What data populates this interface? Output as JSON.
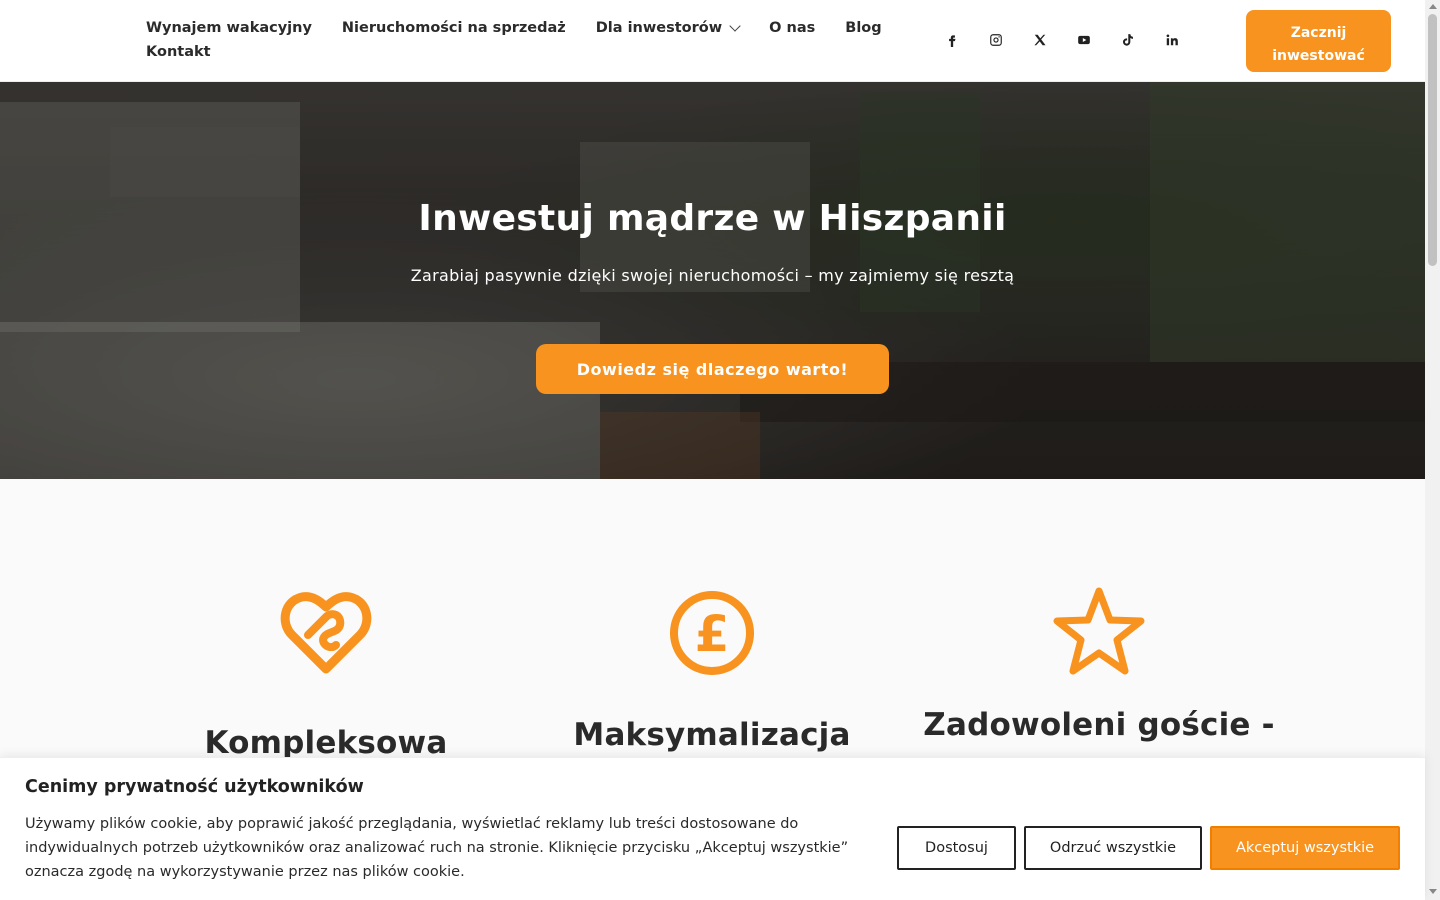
{
  "nav": {
    "items": [
      {
        "label": "Wynajem wakacyjny"
      },
      {
        "label": "Nieruchomości na sprzedaż"
      },
      {
        "label": "Dla inwestorów",
        "has_dropdown": true
      },
      {
        "label": "O nas"
      },
      {
        "label": "Blog"
      }
    ],
    "second_row": {
      "label": "Kontakt"
    }
  },
  "socials": [
    {
      "name": "facebook-icon"
    },
    {
      "name": "instagram-icon"
    },
    {
      "name": "x-twitter-icon"
    },
    {
      "name": "youtube-icon"
    },
    {
      "name": "tiktok-icon"
    },
    {
      "name": "linkedin-icon"
    }
  ],
  "header_cta": {
    "label": "Zacznij inwestować"
  },
  "hero": {
    "title": "Inwestuj mądrze w Hiszpanii",
    "subtitle": "Zarabiaj pasywnie dzięki swojej nieruchomości – my zajmiemy się resztą",
    "button": "Dowiedz się dlaczego warto!"
  },
  "features": [
    {
      "icon": "heart-hands-icon",
      "title": "Kompleksowa"
    },
    {
      "icon": "pound-coin-icon",
      "title": "Maksymalizacja"
    },
    {
      "icon": "star-icon",
      "title": "Zadowoleni goście -"
    }
  ],
  "cookie": {
    "title": "Cenimy prywatność użytkowników",
    "text": "Używamy plików cookie, aby poprawić jakość przeglądania, wyświetlać reklamy lub treści dostosowane do indywidualnych potrzeb użytkowników oraz analizować ruch na stronie. Kliknięcie przycisku „Akceptuj wszystkie” oznacza zgodę na wykorzystywanie przez nas plików cookie.",
    "customize": "Dostosuj",
    "reject": "Odrzuć wszystkie",
    "accept": "Akceptuj wszystkie"
  },
  "colors": {
    "accent": "#f7931e",
    "text": "#222222",
    "background": "#fafafa"
  }
}
